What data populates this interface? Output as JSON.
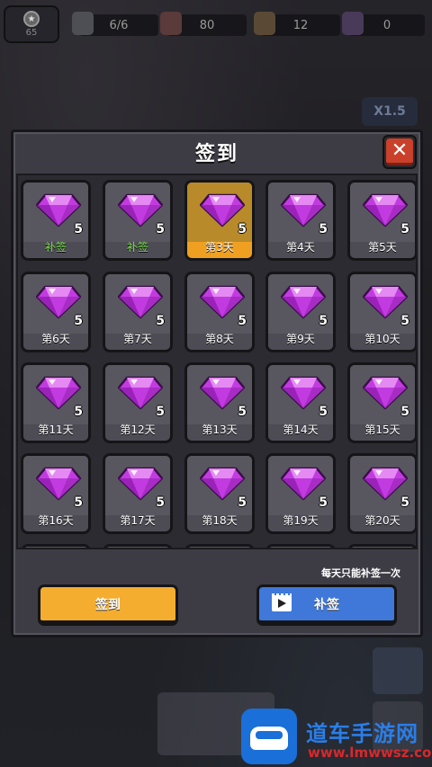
{
  "hud": {
    "level": "65",
    "energy": "6/6",
    "meat": "80",
    "cash": "12",
    "gems": "0",
    "speed": "X1.5"
  },
  "panel": {
    "title": "签到",
    "close_label": "✕"
  },
  "days": [
    {
      "amount": "5",
      "label": "补签",
      "state": "make-up"
    },
    {
      "amount": "5",
      "label": "补签",
      "state": "make-up"
    },
    {
      "amount": "5",
      "label": "第3天",
      "state": "today"
    },
    {
      "amount": "5",
      "label": "第4天",
      "state": "normal"
    },
    {
      "amount": "5",
      "label": "第5天",
      "state": "normal"
    },
    {
      "amount": "5",
      "label": "第6天",
      "state": "normal"
    },
    {
      "amount": "5",
      "label": "第7天",
      "state": "normal"
    },
    {
      "amount": "5",
      "label": "第8天",
      "state": "normal"
    },
    {
      "amount": "5",
      "label": "第9天",
      "state": "normal"
    },
    {
      "amount": "5",
      "label": "第10天",
      "state": "normal"
    },
    {
      "amount": "5",
      "label": "第11天",
      "state": "normal"
    },
    {
      "amount": "5",
      "label": "第12天",
      "state": "normal"
    },
    {
      "amount": "5",
      "label": "第13天",
      "state": "normal"
    },
    {
      "amount": "5",
      "label": "第14天",
      "state": "normal"
    },
    {
      "amount": "5",
      "label": "第15天",
      "state": "normal"
    },
    {
      "amount": "5",
      "label": "第16天",
      "state": "normal"
    },
    {
      "amount": "5",
      "label": "第17天",
      "state": "normal"
    },
    {
      "amount": "5",
      "label": "第18天",
      "state": "normal"
    },
    {
      "amount": "5",
      "label": "第19天",
      "state": "normal"
    },
    {
      "amount": "5",
      "label": "第20天",
      "state": "normal"
    }
  ],
  "note": "每天只能补签一次",
  "buttons": {
    "checkin": "签到",
    "makeup": "补签"
  },
  "colors": {
    "gem": "#c23be0",
    "today": "#f0a020",
    "makeup_text": "#7be04a",
    "checkin_button": "#f4ad2f",
    "makeup_button": "#3f78d9"
  },
  "watermark": {
    "title": "道车手游网",
    "url": "www.lmwwsz.com"
  }
}
